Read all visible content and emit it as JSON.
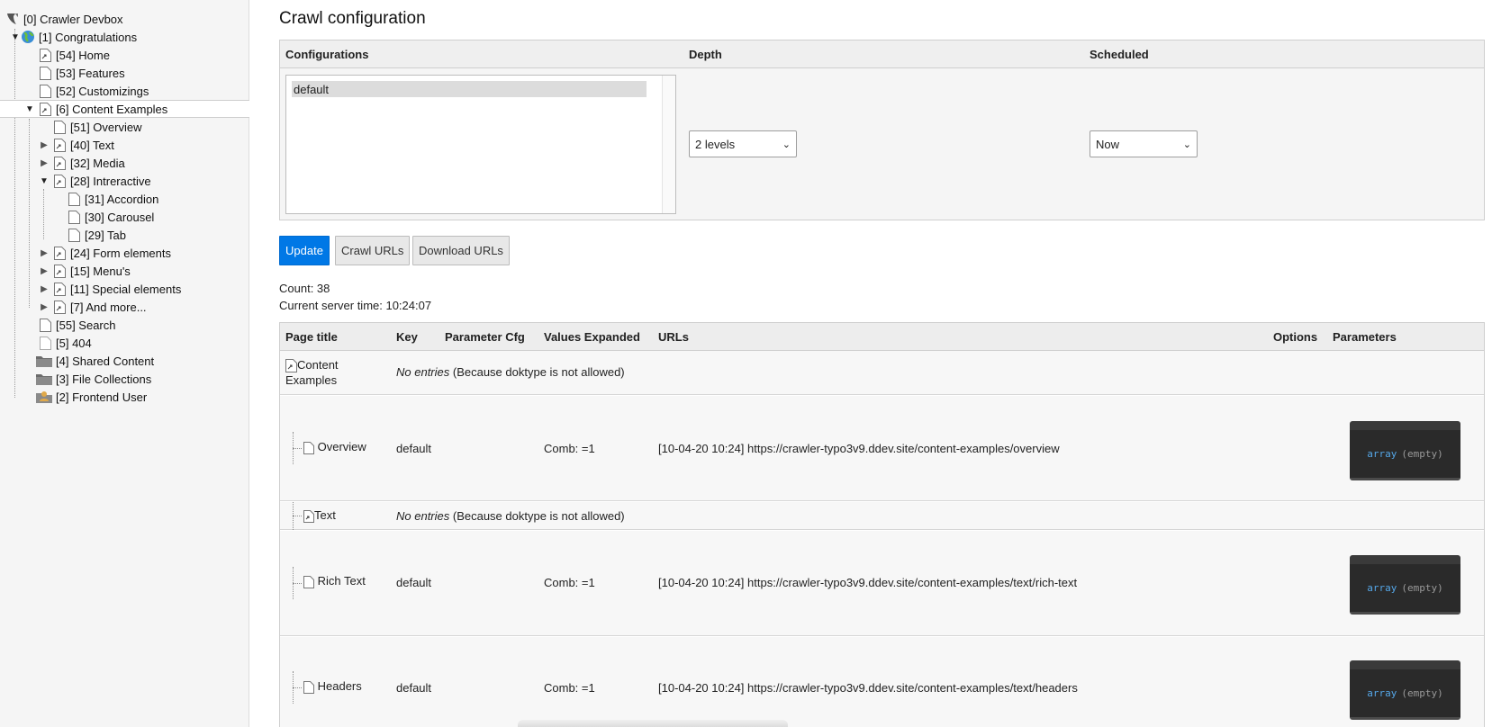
{
  "tree": {
    "nodes": [
      {
        "label": "[0] Crawler Devbox",
        "icon": "typo3-logo-icon"
      },
      {
        "label": "[1] Congratulations",
        "icon": "globe-icon"
      },
      {
        "label": "[54] Home",
        "icon": "shortcut-page-icon"
      },
      {
        "label": "[53] Features",
        "icon": "page-icon"
      },
      {
        "label": "[52] Customizings",
        "icon": "page-icon"
      },
      {
        "label": "[6] Content Examples",
        "icon": "shortcut-page-icon"
      },
      {
        "label": "[51] Overview",
        "icon": "page-icon"
      },
      {
        "label": "[40] Text",
        "icon": "shortcut-page-icon"
      },
      {
        "label": "[32] Media",
        "icon": "shortcut-page-icon"
      },
      {
        "label": "[28] Intreractive",
        "icon": "shortcut-page-icon"
      },
      {
        "label": "[31] Accordion",
        "icon": "page-icon"
      },
      {
        "label": "[30] Carousel",
        "icon": "page-icon"
      },
      {
        "label": "[29] Tab",
        "icon": "page-icon"
      },
      {
        "label": "[24] Form elements",
        "icon": "shortcut-page-icon"
      },
      {
        "label": "[15] Menu's",
        "icon": "shortcut-page-icon"
      },
      {
        "label": "[11] Special elements",
        "icon": "shortcut-page-icon"
      },
      {
        "label": "[7] And more...",
        "icon": "shortcut-page-icon"
      },
      {
        "label": "[55] Search",
        "icon": "page-icon"
      },
      {
        "label": "[5] 404",
        "icon": "page-icon"
      },
      {
        "label": "[4] Shared Content",
        "icon": "folder-icon"
      },
      {
        "label": "[3] File Collections",
        "icon": "folder-icon"
      },
      {
        "label": "[2] Frontend User",
        "icon": "user-folder-icon"
      }
    ]
  },
  "main": {
    "title": "Crawl configuration",
    "config": {
      "col_configurations": "Configurations",
      "col_depth": "Depth",
      "col_scheduled": "Scheduled",
      "configuration_options": [
        "default"
      ],
      "depth_value": "2 levels",
      "scheduled_value": "Now"
    },
    "buttons": {
      "update": "Update",
      "crawl_urls": "Crawl URLs",
      "download_urls": "Download URLs"
    },
    "count_text": "Count: 38",
    "server_time_text": "Current server time: 10:24:07",
    "table": {
      "headers": {
        "page_title": "Page title",
        "key": "Key",
        "parameter_cfg": "Parameter Cfg",
        "values_expanded": "Values Expanded",
        "urls": "URLs",
        "options": "Options",
        "parameters": "Parameters"
      },
      "rows": [
        {
          "title_line1": "Content",
          "title_line2": "Examples",
          "note_em": "No entries",
          "note_rest": " (Because doktype is not allowed)"
        },
        {
          "title": "Overview",
          "key": "default",
          "values": "Comb: =1",
          "url": "[10-04-20 10:24] https://crawler-typo3v9.ddev.site/content-examples/overview",
          "dump_kw": "array",
          "dump_val": "(empty)"
        },
        {
          "title": "Text",
          "note_em": "No entries",
          "note_rest": " (Because doktype is not allowed)"
        },
        {
          "title": "Rich Text",
          "key": "default",
          "values": "Comb: =1",
          "url": "[10-04-20 10:24] https://crawler-typo3v9.ddev.site/content-examples/text/rich-text",
          "dump_kw": "array",
          "dump_val": "(empty)"
        },
        {
          "title": "Headers",
          "key": "default",
          "values": "Comb: =1",
          "url": "[10-04-20 10:24] https://crawler-typo3v9.ddev.site/content-examples/text/headers",
          "dump_kw": "array",
          "dump_val": "(empty)"
        }
      ]
    }
  }
}
